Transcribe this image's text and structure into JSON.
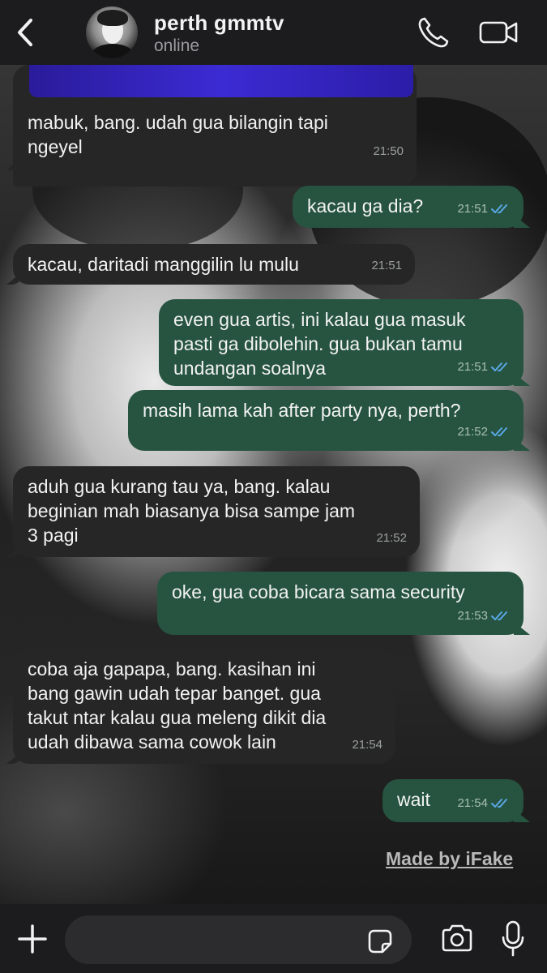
{
  "header": {
    "contact_name": "perth gmmtv",
    "status": "online",
    "icons": {
      "back": "chevron-left-icon",
      "call": "phone-icon",
      "video": "video-camera-icon"
    }
  },
  "messages": [
    {
      "direction": "in",
      "text": "mabuk, bang. udah gua bilangin tapi\nngeyel",
      "time": "21:50"
    },
    {
      "direction": "out",
      "text": "kacau ga dia?",
      "time": "21:51"
    },
    {
      "direction": "in",
      "text": "kacau, daritadi manggilin lu mulu",
      "time": "21:51"
    },
    {
      "direction": "out",
      "text": "even gua artis, ini kalau gua masuk\npasti ga dibolehin. gua bukan tamu\nundangan soalnya",
      "time": "21:51"
    },
    {
      "direction": "out",
      "text": "masih lama kah after party nya, perth?",
      "time": "21:52"
    },
    {
      "direction": "in",
      "text": "aduh gua kurang tau ya, bang. kalau\nbeginian mah biasanya bisa sampe jam\n3 pagi",
      "time": "21:52"
    },
    {
      "direction": "out",
      "text": "oke, gua coba bicara sama security",
      "time": "21:53"
    },
    {
      "direction": "in",
      "text": "coba aja gapapa, bang. kasihan ini\nbang gawin udah tepar banget. gua\ntakut ntar kalau gua meleng dikit dia\nudah dibawa sama cowok lain",
      "time": "21:54"
    },
    {
      "direction": "out",
      "text": "wait",
      "time": "21:54"
    }
  ],
  "watermark": "Made by iFake",
  "composer": {
    "input_value": "",
    "icons": {
      "plus": "plus-icon",
      "sticker": "sticker-icon",
      "camera": "camera-icon",
      "mic": "microphone-icon"
    }
  },
  "colors": {
    "header_bg": "#1c1c1e",
    "incoming_bubble": "#262626",
    "outgoing_bubble": "#265440",
    "read_ticks": "#5aa7e6"
  }
}
